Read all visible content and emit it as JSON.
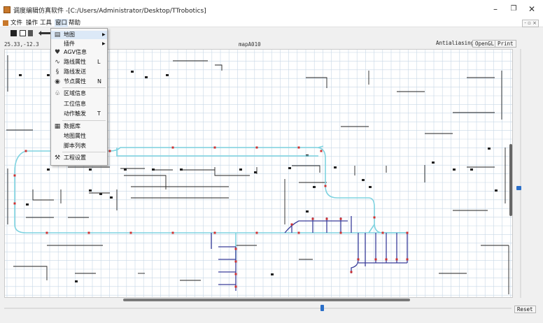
{
  "window": {
    "title": "调度编辑仿真软件 -[C:/Users/Administrator/Desktop/TTrobotics]",
    "min_glyph": "–",
    "max_glyph": "❐",
    "close_glyph": "✕"
  },
  "menubar": {
    "items": [
      "文件",
      "操作",
      "工具",
      "窗口",
      "帮助"
    ],
    "mdi_controls": "- ▫ ×"
  },
  "infobar": {
    "coords": "25.33,-12.3",
    "map_name": "mapA010",
    "antialiasing": "Antialiasing",
    "opengl": "OpenGL",
    "print": "Print"
  },
  "reset_label": "Reset",
  "dropdown": {
    "items": [
      {
        "label": "地图",
        "icon": "map-icon",
        "glyph": "▤",
        "shortcut": "",
        "submenu": true
      },
      {
        "label": "插件",
        "icon": "",
        "glyph": "",
        "shortcut": "",
        "submenu": true
      },
      {
        "label": "AGV信息",
        "icon": "heart-icon",
        "glyph": "♥",
        "shortcut": "",
        "submenu": false
      },
      {
        "label": "路线属性",
        "icon": "route-icon",
        "glyph": "∿",
        "shortcut": "L",
        "submenu": false
      },
      {
        "label": "路线发送",
        "icon": "send-route-icon",
        "glyph": "§",
        "shortcut": "",
        "submenu": false
      },
      {
        "label": "节点属性",
        "icon": "node-icon",
        "glyph": "◉",
        "shortcut": "N",
        "submenu": false
      },
      {
        "label": "区域信息",
        "icon": "area-icon",
        "glyph": "♧",
        "shortcut": "",
        "submenu": false
      },
      {
        "label": "工位信息",
        "icon": "",
        "glyph": "",
        "shortcut": "",
        "submenu": false
      },
      {
        "label": "动作触发",
        "icon": "",
        "glyph": "",
        "shortcut": "T",
        "submenu": false
      },
      {
        "label": "数据库",
        "icon": "database-icon",
        "glyph": "▦",
        "shortcut": "",
        "submenu": false
      },
      {
        "label": "地图属性",
        "icon": "",
        "glyph": "",
        "shortcut": "",
        "submenu": false
      },
      {
        "label": "脚本列表",
        "icon": "",
        "glyph": "",
        "shortcut": "",
        "submenu": false
      },
      {
        "label": "工程设置",
        "icon": "tools-icon",
        "glyph": "⚒",
        "shortcut": "",
        "submenu": false
      }
    ]
  },
  "colors": {
    "route": "#7fd3e0",
    "route_dark": "#3b3f9a",
    "node": "#d03030",
    "grid": "#c7d7e6",
    "accent": "#2a6fc9"
  }
}
